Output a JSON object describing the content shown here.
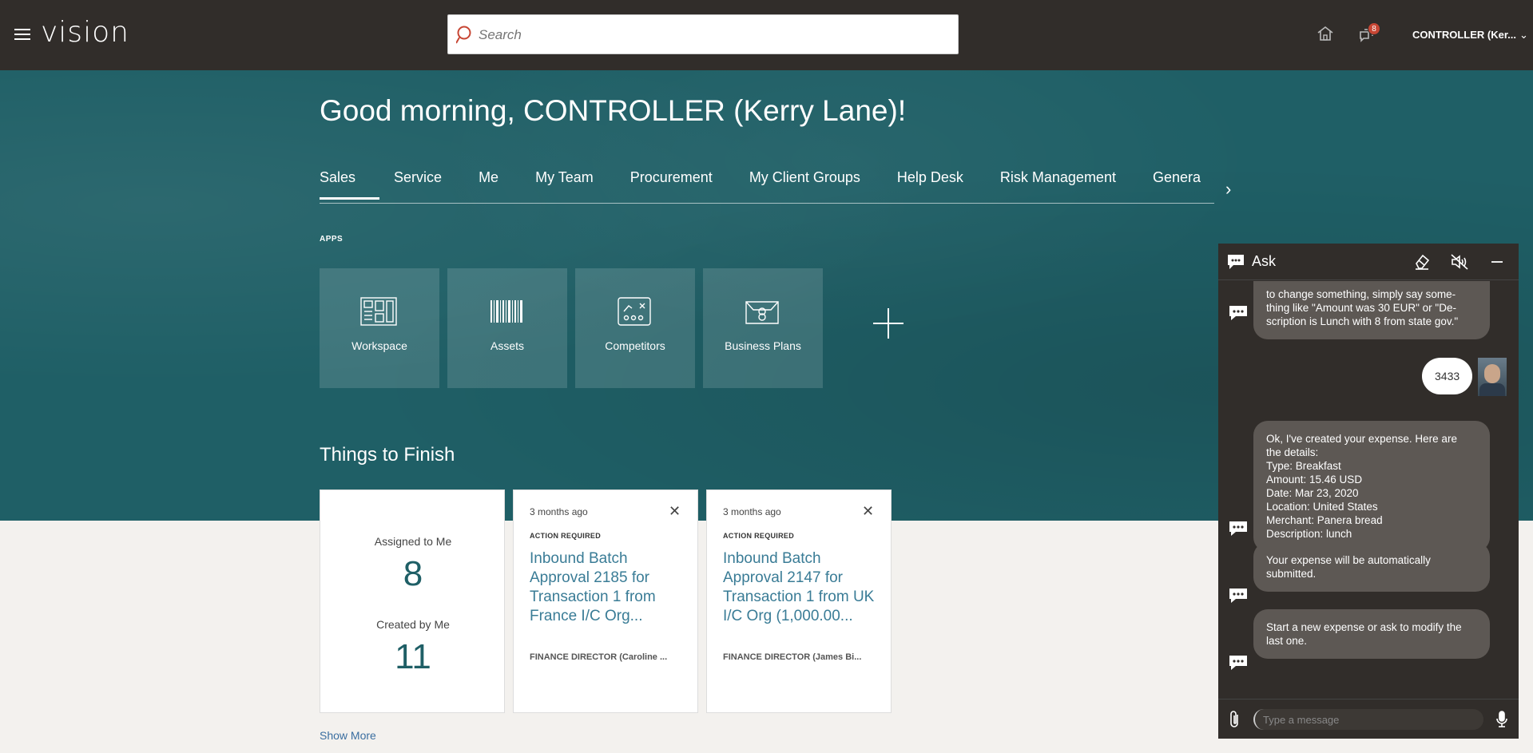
{
  "header": {
    "logo": "vision",
    "search_placeholder": "Search",
    "notifications_count": "8",
    "user_label": "CONTROLLER (Ker..."
  },
  "hero": {
    "greeting": "Good morning, CONTROLLER (Kerry Lane)!",
    "tabs": [
      "Sales",
      "Service",
      "Me",
      "My Team",
      "Procurement",
      "My Client Groups",
      "Help Desk",
      "Risk Management",
      "Genera"
    ],
    "active_tab": "Sales",
    "apps_label": "APPS",
    "apps": [
      {
        "label": "Workspace",
        "icon": "workspace-icon"
      },
      {
        "label": "Assets",
        "icon": "barcode-icon"
      },
      {
        "label": "Competitors",
        "icon": "competitors-icon"
      },
      {
        "label": "Business Plans",
        "icon": "briefcase-icon"
      }
    ],
    "things_title": "Things to Finish"
  },
  "things": {
    "summary": {
      "assigned_label": "Assigned to Me",
      "assigned_count": "8",
      "created_label": "Created by Me",
      "created_count": "11"
    },
    "cards": [
      {
        "time": "3 months ago",
        "status": "ACTION REQUIRED",
        "title": "Inbound Batch Approval 2185 for Transaction 1 from France I/C Org...",
        "person": "FINANCE DIRECTOR (Caroline ..."
      },
      {
        "time": "3 months ago",
        "status": "ACTION REQUIRED",
        "title": "Inbound Batch Approval 2147 for Transaction 1 from UK I/C Org (1,000.00...",
        "person": "FINANCE DIRECTOR (James Bi..."
      }
    ],
    "show_more": "Show More"
  },
  "chat": {
    "title": "Ask",
    "messages": {
      "partial": "to change something, simply say some-\nthing like \"Amount was 30 EUR\" or \"De-\nscription is Lunch with 8 from state gov.\"",
      "user": "3433",
      "details": "Ok, I've created your expense. Here are\nthe details:\nType: Breakfast\nAmount: 15.46 USD\nDate: Mar 23, 2020\nLocation: United States\nMerchant: Panera bread\nDescription: lunch",
      "submitted": "Your expense will be automatically\nsubmitted.",
      "next": "Start a new expense or ask to modify the\nlast one."
    },
    "input_placeholder": "Type a message"
  }
}
